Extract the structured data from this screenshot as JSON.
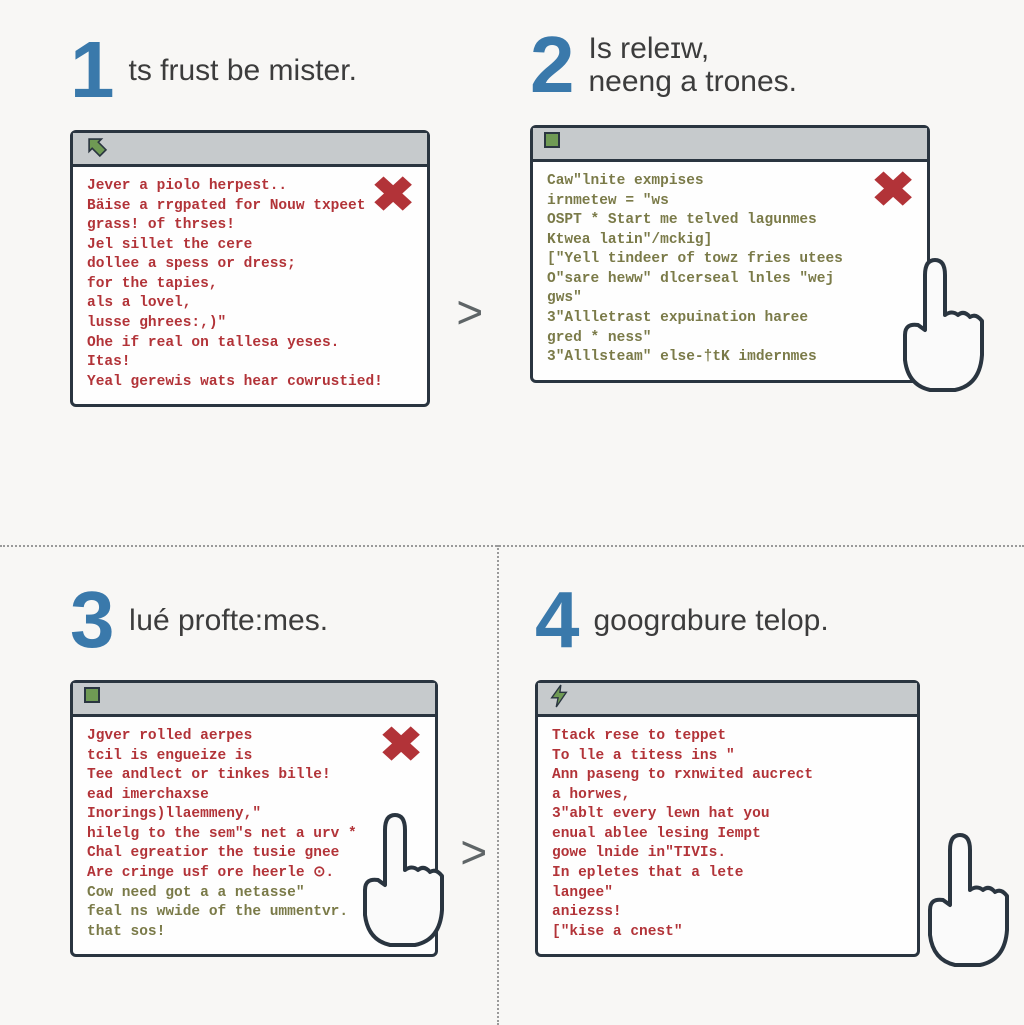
{
  "steps": {
    "s1": {
      "number": "1",
      "title": "ts frust be mister.",
      "body": "Jever a piolo herpest..\nBäise a rrgpated for Nouw txpeet\n grass! of thrses!\nJel sillet the cere\n dollee a spess or dress;\n for the tapies,\n als a lovel,\n lusse ghrees:,)\"\nOhe if real on tallesa yeses.\nItas!\nYeal gerewis wats hear cowrustied!"
    },
    "s2": {
      "number": "2",
      "title": "Is releɪw,\nneeng a trones.",
      "body": "Caw\"lnite exmpises\nirnmetew = \"ws\nOSPT * Start me telved lagunmes\nKtwea latin\"/mckig]\n[\"Yell tindeer of towz fries utees\nO\"sare heww\" dlcerseal lnles \"wej\ngws\"\n3\"Allletrast expuination haree\ngred * ness\"\n3\"Alllsteam\" else-†tK imdernmes"
    },
    "s3": {
      "number": "3",
      "title": "ǀué profte:mes.",
      "body_main": "Jgver rolled aerpes\ntcil is engueize is\nTee andlect or tinkes bille!\nead imerchaxse\nInorings)llaemmeny,\"\nhilelg to the sem\"s net a urv  *\nChal egreatior the tusie gnee\nAre cringe usf ore heerle ⊙.",
      "body_alt": "Cow need got a a netasse\"\nfeal ns wwide  of the ummentvr.\nthat sos!"
    },
    "s4": {
      "number": "4",
      "title": "googrɑbure telop.",
      "body": "Ttack rese to teppet\nTo lle a titess ins \"\nAnn paseng to rxnwited aucrect\na horwes,\n3\"ablt every lewn hat you\nenual ablee lesing Iempt\ngowe lnide in\"TIVIs.\nIn epletes that a lete\nlangee\"\naniezss!\n[\"kise a cnest\""
    }
  },
  "arrows": {
    "right1": ">",
    "right2": ">"
  }
}
